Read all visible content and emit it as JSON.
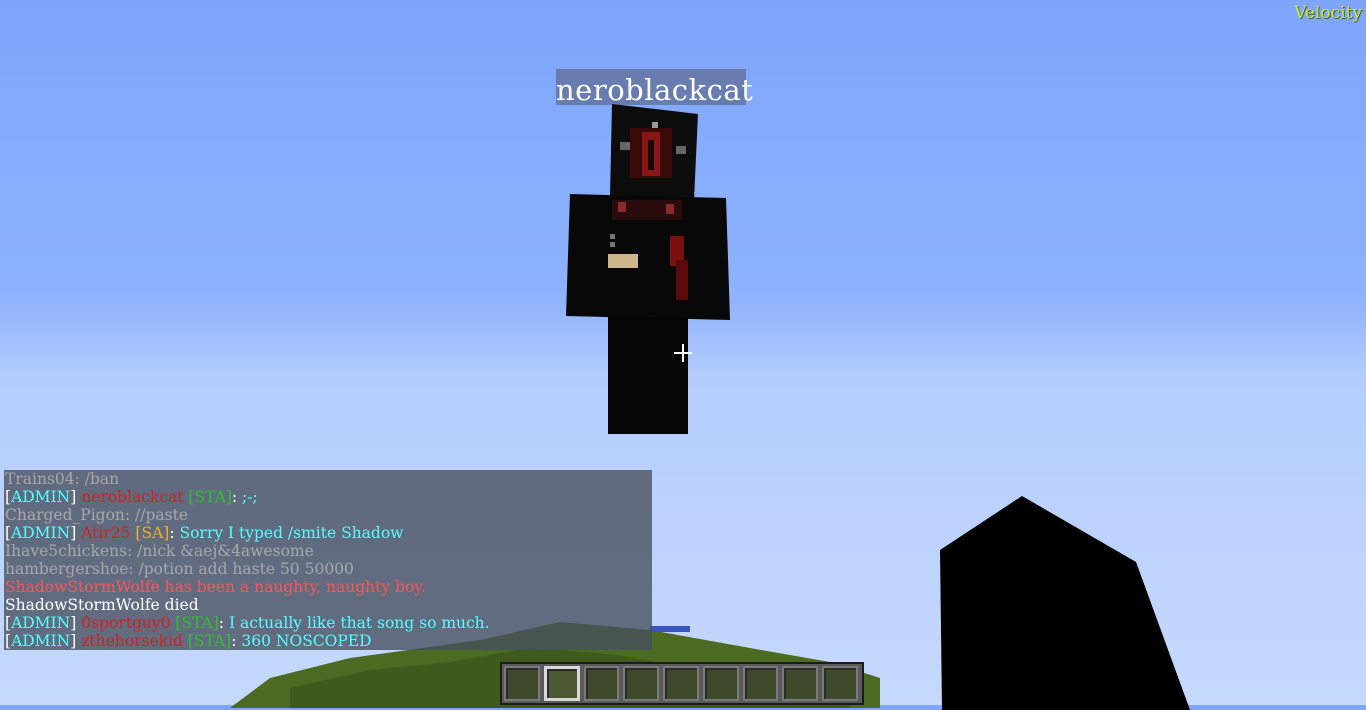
{
  "hud": {
    "mod_label": "Velocity",
    "nametag": "neroblackcat"
  },
  "chat": [
    {
      "segments": [
        {
          "text": "Trains04: /ban",
          "color": "gray"
        }
      ]
    },
    {
      "segments": [
        {
          "text": "[",
          "color": "white"
        },
        {
          "text": "ADMIN",
          "color": "aqua"
        },
        {
          "text": "] ",
          "color": "white"
        },
        {
          "text": "neroblackcat",
          "color": "red"
        },
        {
          "text": " [STA]",
          "color": "green"
        },
        {
          "text": ": ",
          "color": "white"
        },
        {
          "text": ";-;",
          "color": "aqua"
        }
      ]
    },
    {
      "segments": [
        {
          "text": "Charged_Pigon: //paste",
          "color": "gray"
        }
      ]
    },
    {
      "segments": [
        {
          "text": "[",
          "color": "white"
        },
        {
          "text": "ADMIN",
          "color": "aqua"
        },
        {
          "text": "] ",
          "color": "white"
        },
        {
          "text": "Atir25",
          "color": "red"
        },
        {
          "text": " [SA]",
          "color": "gold"
        },
        {
          "text": ": ",
          "color": "white"
        },
        {
          "text": "Sorry I typed /smite Shadow",
          "color": "aqua"
        }
      ]
    },
    {
      "segments": [
        {
          "text": "Ihave5chickens: /nick &aej&4awesome",
          "color": "gray"
        }
      ]
    },
    {
      "segments": [
        {
          "text": "hambergershoe: /potion add haste 50 50000",
          "color": "gray"
        }
      ]
    },
    {
      "segments": [
        {
          "text": "ShadowStormWolfe has been a naughty, naughty boy.",
          "color": "pink"
        }
      ]
    },
    {
      "segments": [
        {
          "text": "ShadowStormWolfe died",
          "color": "white"
        }
      ]
    },
    {
      "segments": [
        {
          "text": "[",
          "color": "white"
        },
        {
          "text": "ADMIN",
          "color": "aqua"
        },
        {
          "text": "] ",
          "color": "white"
        },
        {
          "text": "0sportguy0",
          "color": "red"
        },
        {
          "text": " [STA]",
          "color": "green"
        },
        {
          "text": ": ",
          "color": "white"
        },
        {
          "text": "I actually like that song so much.",
          "color": "aqua"
        }
      ]
    },
    {
      "segments": [
        {
          "text": "[",
          "color": "white"
        },
        {
          "text": "ADMIN",
          "color": "aqua"
        },
        {
          "text": "] ",
          "color": "white"
        },
        {
          "text": "zthehorsekid",
          "color": "red"
        },
        {
          "text": " [STA]",
          "color": "green"
        },
        {
          "text": ": ",
          "color": "white"
        },
        {
          "text": "360 NOSCOPED",
          "color": "aqua"
        }
      ]
    }
  ],
  "hotbar": {
    "slot_count": 9,
    "selected_slot": 2
  },
  "colors": {
    "sky_top": "#7da5fb",
    "sky_bottom": "#c6d9fd",
    "chat_bg": "#464e5c"
  }
}
